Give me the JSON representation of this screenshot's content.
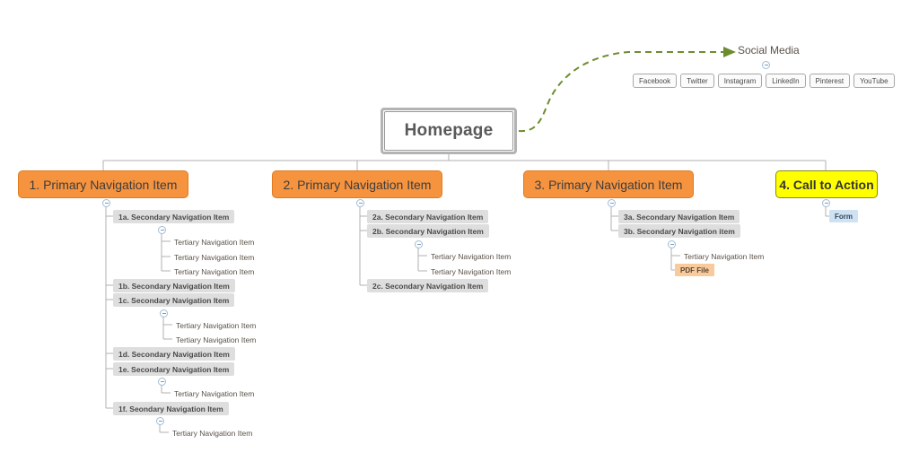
{
  "diagram": {
    "type": "sitemap",
    "title": "Website Sitemap",
    "colors": {
      "primary_fill": "#f5933f",
      "primary_border": "#e07b20",
      "cta_fill": "#ffff00",
      "cta_border": "#8c8c00",
      "secondary_fill": "#dedede",
      "pdf_fill": "#f9cb9c",
      "form_fill": "#cfe2f3",
      "connector": "#b0b0b0",
      "social_link": "#6d8c2f",
      "homepage_border": "#b3b3b3"
    }
  },
  "root": {
    "label": "Homepage"
  },
  "social": {
    "title": "Social Media",
    "link_style": "dashed-arrow",
    "buttons": [
      {
        "label": "Facebook"
      },
      {
        "label": "Twitter"
      },
      {
        "label": "Instagram"
      },
      {
        "label": "LinkedIn"
      },
      {
        "label": "Pinterest"
      },
      {
        "label": "YouTube"
      }
    ]
  },
  "columns": [
    {
      "primary": "1. Primary Navigation Item",
      "kind": "primary",
      "children": [
        {
          "label": "1a. Secondary Navigation Item",
          "children": [
            {
              "label": "Tertiary Navigation Item"
            },
            {
              "label": "Tertiary Navigation Item"
            },
            {
              "label": "Tertiary Navigation Item"
            }
          ]
        },
        {
          "label": "1b. Secondary Navigation Item",
          "children": []
        },
        {
          "label": "1c. Secondary Navigation Item",
          "children": [
            {
              "label": "Tertiary Navigation Item"
            },
            {
              "label": "Tertiary Navigation Item"
            }
          ]
        },
        {
          "label": "1d. Secondary Navigation Item",
          "children": []
        },
        {
          "label": "1e. Secondary Navigation Item",
          "children": [
            {
              "label": "Tertiary Navigation Item"
            }
          ]
        },
        {
          "label": "1f. Seondary Navigation Item",
          "children": [
            {
              "label": "Tertiary Navigation Item"
            }
          ]
        }
      ]
    },
    {
      "primary": "2. Primary Navigation Item",
      "kind": "primary",
      "children": [
        {
          "label": "2a. Secondary Navigation Item",
          "children": []
        },
        {
          "label": "2b. Secondary Navigation Item",
          "children": [
            {
              "label": "Tertiary Navigation Item"
            },
            {
              "label": "Tertiary Navigation Item"
            }
          ]
        },
        {
          "label": "2c. Secondary Navigation Item",
          "children": []
        }
      ]
    },
    {
      "primary": "3. Primary Navigation Item",
      "kind": "primary",
      "children": [
        {
          "label": "3a. Secondary Navigation Item",
          "children": []
        },
        {
          "label": "3b. Secondary Navigation item",
          "children": [
            {
              "label": "Tertiary Navigation Item"
            },
            {
              "label": "PDF File",
              "asset": "pdf"
            }
          ]
        }
      ]
    },
    {
      "primary": "4. Call to Action",
      "kind": "cta",
      "children": [
        {
          "label": "Form",
          "asset": "form"
        }
      ]
    }
  ],
  "nodes": {
    "c1": {
      "primary": "1. Primary Navigation Item",
      "s1a": "1a. Secondary Navigation Item",
      "s1b": "1b. Secondary Navigation Item",
      "s1c": "1c. Secondary Navigation Item",
      "s1d": "1d. Secondary Navigation Item",
      "s1e": "1e. Secondary Navigation Item",
      "s1f": "1f. Seondary Navigation Item",
      "t1": "Tertiary Navigation Item",
      "t2": "Tertiary Navigation Item",
      "t3": "Tertiary Navigation Item",
      "t4": "Tertiary Navigation Item",
      "t5": "Tertiary Navigation Item",
      "t6": "Tertiary Navigation Item",
      "t7": "Tertiary Navigation Item"
    },
    "c2": {
      "primary": "2. Primary Navigation Item",
      "s2a": "2a. Secondary Navigation Item",
      "s2b": "2b. Secondary Navigation Item",
      "s2c": "2c. Secondary Navigation Item",
      "t1": "Tertiary Navigation Item",
      "t2": "Tertiary Navigation Item"
    },
    "c3": {
      "primary": "3. Primary Navigation Item",
      "s3a": "3a. Secondary Navigation Item",
      "s3b": "3b. Secondary Navigation item",
      "t1": "Tertiary Navigation Item",
      "pdf": "PDF File"
    },
    "c4": {
      "primary": "4. Call to Action",
      "form": "Form"
    }
  }
}
